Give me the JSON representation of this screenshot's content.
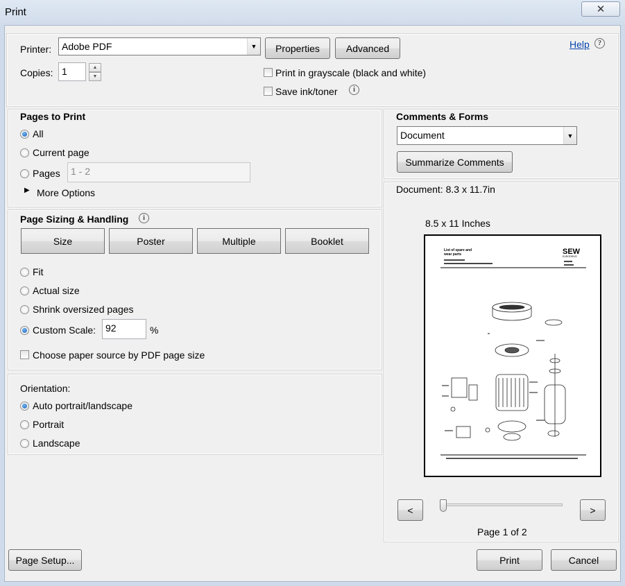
{
  "window": {
    "title": "Print",
    "close_glyph": "✕"
  },
  "printer": {
    "label": "Printer:",
    "selected": "Adobe PDF",
    "properties_label": "Properties",
    "advanced_label": "Advanced",
    "help_label": "Help",
    "copies_label": "Copies:",
    "copies_value": "1",
    "grayscale_label": "Print in grayscale (black and white)",
    "grayscale_checked": false,
    "save_ink_label": "Save ink/toner",
    "save_ink_checked": false
  },
  "pages_to_print": {
    "title": "Pages to Print",
    "all_label": "All",
    "current_label": "Current page",
    "pages_label": "Pages",
    "pages_value": "1 - 2",
    "more_options_label": "More Options",
    "selected": "all"
  },
  "sizing": {
    "title": "Page Sizing & Handling",
    "tabs": [
      "Size",
      "Poster",
      "Multiple",
      "Booklet"
    ],
    "fit_label": "Fit",
    "actual_label": "Actual size",
    "shrink_label": "Shrink oversized pages",
    "custom_label": "Custom Scale:",
    "custom_value": "92",
    "percent": "%",
    "paper_source_label": "Choose paper source by PDF page size",
    "selected": "custom"
  },
  "orientation": {
    "title": "Orientation:",
    "auto_label": "Auto portrait/landscape",
    "portrait_label": "Portrait",
    "landscape_label": "Landscape",
    "selected": "auto"
  },
  "comments": {
    "title": "Comments & Forms",
    "selected": "Document",
    "summarize_label": "Summarize Comments"
  },
  "preview": {
    "document_size": "Document: 8.3 x 11.7in",
    "paper_size": "8.5 x 11 Inches",
    "prev_label": "<",
    "next_label": ">",
    "page_indicator": "Page 1 of 2",
    "page_current": 1,
    "page_total": 2,
    "doc_title_line1": "List of spare and",
    "doc_title_line2": "wear parts",
    "doc_logo": "SEW",
    "doc_logo_sub": "EURODRIVE"
  },
  "footer": {
    "page_setup_label": "Page Setup...",
    "print_label": "Print",
    "cancel_label": "Cancel"
  }
}
